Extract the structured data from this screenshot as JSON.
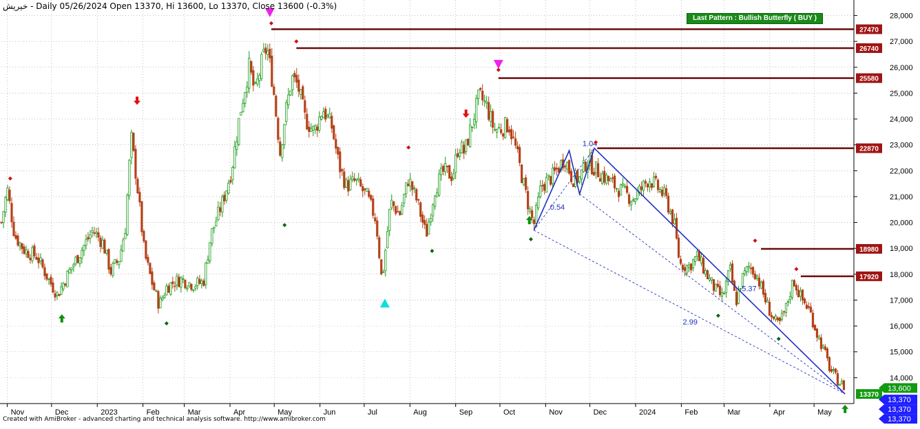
{
  "header": {
    "text": "خیریش - Daily 05/26/2024 Open 13370, Hi 13600, Lo 13370, Close 13600 (-0.3%)"
  },
  "footer": {
    "text": "Created with AmiBroker - advanced charting and technical analysis software. http://www.amibroker.com"
  },
  "pattern_label": "Last Pattern : Bullish Butterfly ( BUY )",
  "colors": {
    "up_candle": "#1a9a1a",
    "down_candle": "#b5421a",
    "resistance": "#6b0b0b",
    "label_bg": "#a01414",
    "pattern_line": "#1f2fbf",
    "price_tag": "#129a12",
    "blue_tag": "#1f1fff",
    "grid": "#9a9a9a"
  },
  "chart_data": {
    "type": "candlestick",
    "title": "",
    "ylim": [
      13000,
      28600
    ],
    "y_ticks": [
      "14,000",
      "15,000",
      "16,000",
      "17,000",
      "18,000",
      "19,000",
      "20,000",
      "21,000",
      "22,000",
      "23,000",
      "24,000",
      "25,000",
      "26,000",
      "27,000",
      "28,000"
    ],
    "y_tick_values": [
      14000,
      15000,
      16000,
      17000,
      18000,
      19000,
      20000,
      21000,
      22000,
      23000,
      24000,
      25000,
      26000,
      27000,
      28000
    ],
    "x_ticks": [
      {
        "label": "Nov",
        "day": 0
      },
      {
        "label": "Dec",
        "day": 30
      },
      {
        "label": "2023",
        "day": 61
      },
      {
        "label": "Feb",
        "day": 92
      },
      {
        "label": "Mar",
        "day": 120
      },
      {
        "label": "Apr",
        "day": 151
      },
      {
        "label": "May",
        "day": 181
      },
      {
        "label": "Jun",
        "day": 212
      },
      {
        "label": "Jul",
        "day": 242
      },
      {
        "label": "Aug",
        "day": 273
      },
      {
        "label": "Sep",
        "day": 304
      },
      {
        "label": "Oct",
        "day": 334
      },
      {
        "label": "Nov",
        "day": 365
      },
      {
        "label": "Dec",
        "day": 395
      },
      {
        "label": "2024",
        "day": 426
      },
      {
        "label": "Feb",
        "day": 457
      },
      {
        "label": "Mar",
        "day": 486
      },
      {
        "label": "Apr",
        "day": 517
      },
      {
        "label": "May",
        "day": 547
      }
    ],
    "x_range_days": [
      -4,
      574
    ],
    "price_path": [
      [
        -4,
        20000
      ],
      [
        0,
        21300
      ],
      [
        5,
        19500
      ],
      [
        12,
        18900
      ],
      [
        20,
        18700
      ],
      [
        28,
        17800
      ],
      [
        34,
        17200
      ],
      [
        42,
        18100
      ],
      [
        50,
        18900
      ],
      [
        58,
        19700
      ],
      [
        65,
        19200
      ],
      [
        70,
        18100
      ],
      [
        76,
        18600
      ],
      [
        80,
        19800
      ],
      [
        84,
        23300
      ],
      [
        88,
        21500
      ],
      [
        93,
        18800
      ],
      [
        98,
        17700
      ],
      [
        103,
        16800
      ],
      [
        108,
        17500
      ],
      [
        113,
        17700
      ],
      [
        118,
        17800
      ],
      [
        126,
        17600
      ],
      [
        133,
        17700
      ],
      [
        138,
        19500
      ],
      [
        146,
        20800
      ],
      [
        152,
        22000
      ],
      [
        158,
        24300
      ],
      [
        164,
        26000
      ],
      [
        168,
        25000
      ],
      [
        173,
        26300
      ],
      [
        176,
        26800
      ],
      [
        180,
        25400
      ],
      [
        185,
        22700
      ],
      [
        188,
        24000
      ],
      [
        193,
        25600
      ],
      [
        197,
        25300
      ],
      [
        202,
        24000
      ],
      [
        208,
        23500
      ],
      [
        214,
        24400
      ],
      [
        220,
        23700
      ],
      [
        225,
        22200
      ],
      [
        230,
        21400
      ],
      [
        236,
        21600
      ],
      [
        244,
        21000
      ],
      [
        250,
        20100
      ],
      [
        254,
        17700
      ],
      [
        260,
        20800
      ],
      [
        266,
        20300
      ],
      [
        272,
        21700
      ],
      [
        278,
        20800
      ],
      [
        284,
        19500
      ],
      [
        290,
        21300
      ],
      [
        296,
        22000
      ],
      [
        302,
        21800
      ],
      [
        306,
        23000
      ],
      [
        310,
        22700
      ],
      [
        315,
        23800
      ],
      [
        320,
        24900
      ],
      [
        325,
        24500
      ],
      [
        330,
        23600
      ],
      [
        334,
        23600
      ],
      [
        340,
        23800
      ],
      [
        345,
        22800
      ],
      [
        350,
        21500
      ],
      [
        354,
        20500
      ],
      [
        357,
        19900
      ],
      [
        362,
        21400
      ],
      [
        370,
        21800
      ],
      [
        378,
        22500
      ],
      [
        383,
        21700
      ],
      [
        388,
        21700
      ],
      [
        393,
        22400
      ],
      [
        398,
        22100
      ],
      [
        404,
        21800
      ],
      [
        410,
        21500
      ],
      [
        417,
        21200
      ],
      [
        424,
        20900
      ],
      [
        430,
        21300
      ],
      [
        435,
        21700
      ],
      [
        440,
        21400
      ],
      [
        446,
        21000
      ],
      [
        452,
        20000
      ],
      [
        456,
        18400
      ],
      [
        462,
        18300
      ],
      [
        468,
        18700
      ],
      [
        474,
        18000
      ],
      [
        480,
        17400
      ],
      [
        485,
        17100
      ],
      [
        490,
        18200
      ],
      [
        494,
        16900
      ],
      [
        498,
        17800
      ],
      [
        503,
        18300
      ],
      [
        508,
        18000
      ],
      [
        514,
        17000
      ],
      [
        519,
        16300
      ],
      [
        523,
        16000
      ],
      [
        528,
        16700
      ],
      [
        533,
        17800
      ],
      [
        538,
        17100
      ],
      [
        544,
        16600
      ],
      [
        549,
        15700
      ],
      [
        554,
        15000
      ],
      [
        558,
        14300
      ],
      [
        563,
        13900
      ],
      [
        568,
        13600
      ]
    ],
    "annotations": [
      {
        "text": "1.04",
        "day": 390,
        "price": 22950
      },
      {
        "text": "0.54",
        "day": 368,
        "price": 20500
      },
      {
        "text": "5.37",
        "day": 498,
        "price": 17350
      },
      {
        "text": "2.99",
        "day": 458,
        "price": 16050
      }
    ],
    "resistance_levels": [
      {
        "price": 27470,
        "label": "27470",
        "from_day": 179
      },
      {
        "price": 26740,
        "label": "26740",
        "from_day": 196
      },
      {
        "price": 25580,
        "label": "25580",
        "from_day": 333
      },
      {
        "price": 22870,
        "label": "22870",
        "from_day": 400
      },
      {
        "price": 18980,
        "label": "18980",
        "from_day": 511
      },
      {
        "price": 17920,
        "label": "17920",
        "from_day": 538
      }
    ],
    "current_price_tags": [
      "13,600",
      "13,370",
      "13,370",
      "13,370"
    ],
    "bottom_level_label": "13370",
    "pattern_lines": [
      {
        "style": "solid",
        "points": [
          [
            357,
            19700
          ],
          [
            381,
            22780
          ],
          [
            388,
            21100
          ],
          [
            398,
            22870
          ],
          [
            568,
            13370
          ]
        ]
      },
      {
        "style": "dashed",
        "points": [
          [
            357,
            19700
          ],
          [
            568,
            13370
          ]
        ]
      },
      {
        "style": "dashed",
        "points": [
          [
            388,
            21100
          ],
          [
            568,
            13370
          ]
        ]
      },
      {
        "style": "dashed",
        "points": [
          [
            357,
            19700
          ],
          [
            398,
            22870
          ]
        ]
      }
    ],
    "markers": [
      {
        "kind": "red-down-arrow",
        "day": 88,
        "price": 24600
      },
      {
        "kind": "red-down-arrow",
        "day": 311,
        "price": 24100
      },
      {
        "kind": "magenta-triangle-down",
        "day": 178,
        "price": 28100
      },
      {
        "kind": "magenta-triangle-down",
        "day": 333,
        "price": 26100
      },
      {
        "kind": "cyan-triangle-up",
        "day": 256,
        "price": 16900
      },
      {
        "kind": "green-up-arrow",
        "day": 37,
        "price": 16400
      },
      {
        "kind": "green-up-arrow",
        "day": 354,
        "price": 20200
      },
      {
        "kind": "green-up-arrow",
        "day": 568,
        "price": 12900
      },
      {
        "kind": "red-dot",
        "day": 2,
        "price": 21700
      },
      {
        "kind": "red-dot",
        "day": 179,
        "price": 27700
      },
      {
        "kind": "red-dot",
        "day": 196,
        "price": 27000
      },
      {
        "kind": "red-dot",
        "day": 272,
        "price": 22900
      },
      {
        "kind": "red-dot",
        "day": 333,
        "price": 25900
      },
      {
        "kind": "red-dot",
        "day": 399,
        "price": 23100
      },
      {
        "kind": "red-dot",
        "day": 507,
        "price": 19300
      },
      {
        "kind": "red-dot",
        "day": 535,
        "price": 18200
      },
      {
        "kind": "green-dot",
        "day": 108,
        "price": 16100
      },
      {
        "kind": "green-dot",
        "day": 188,
        "price": 19900
      },
      {
        "kind": "green-dot",
        "day": 288,
        "price": 18900
      },
      {
        "kind": "green-dot",
        "day": 355,
        "price": 19350
      },
      {
        "kind": "green-dot",
        "day": 482,
        "price": 16400
      },
      {
        "kind": "green-dot",
        "day": 523,
        "price": 15500
      }
    ]
  }
}
